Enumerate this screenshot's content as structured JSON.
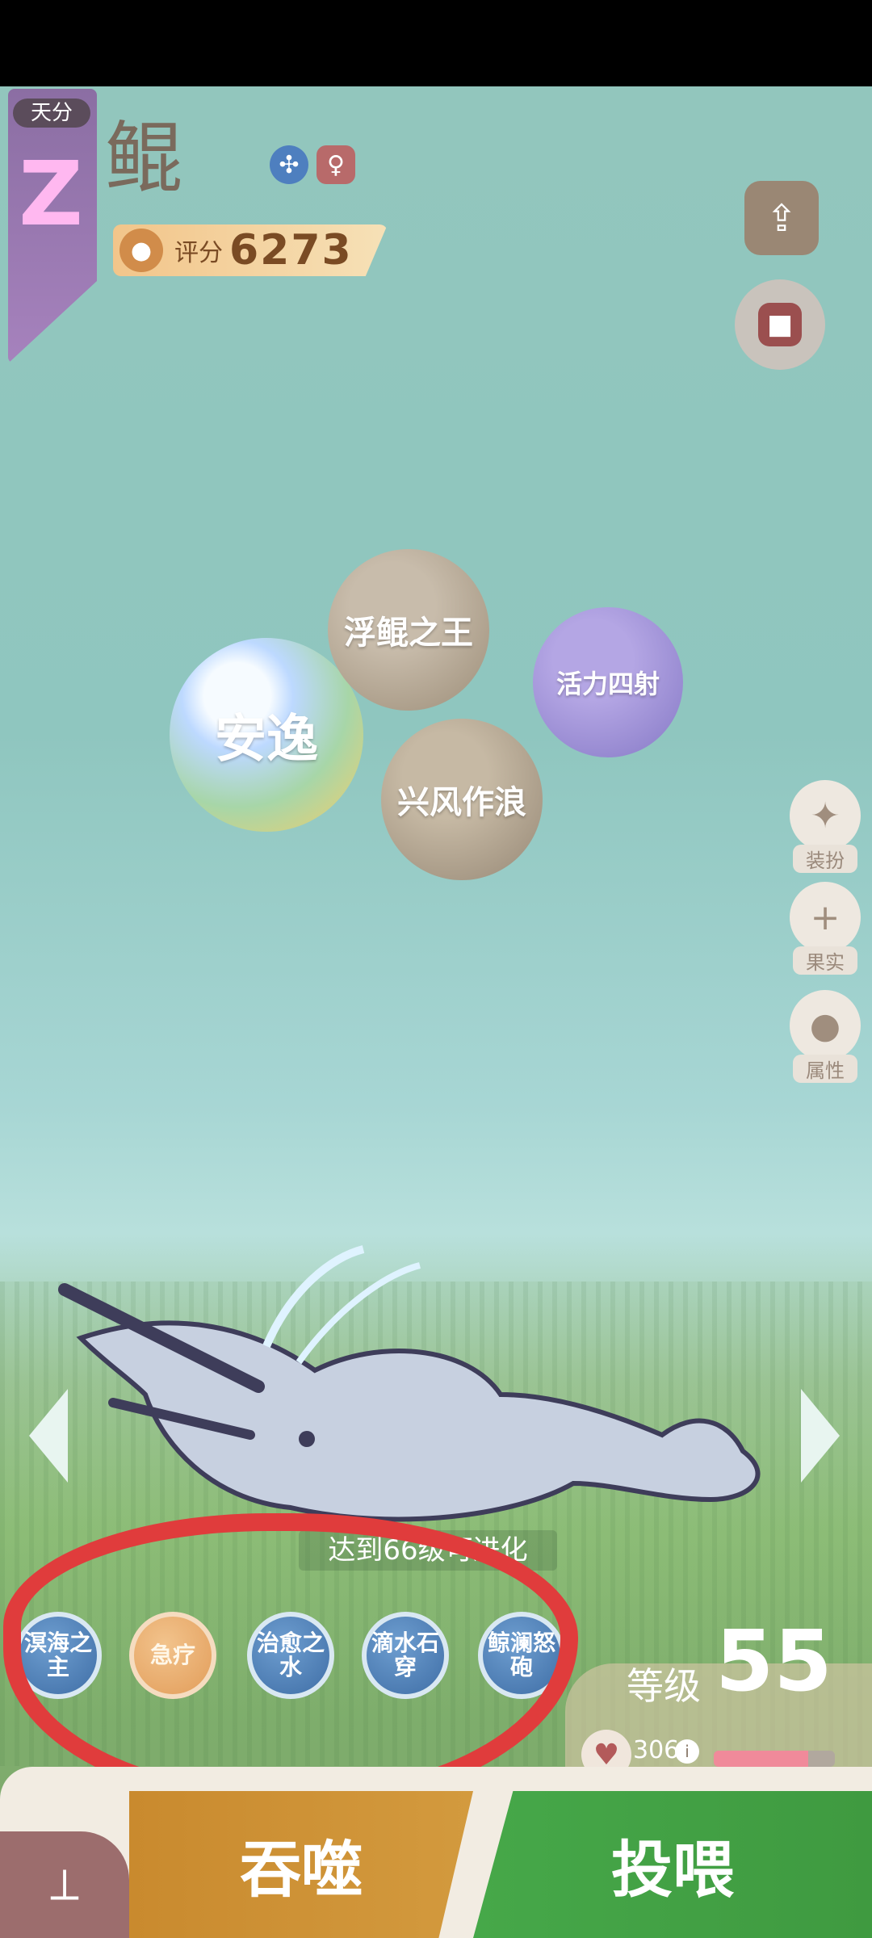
{
  "header": {
    "rank_tag": "天分",
    "rank_letter": "Z",
    "name": "鲲",
    "gender_symbol": "♀",
    "score_label": "评分",
    "score_value": "6273"
  },
  "bubbles": [
    "安逸",
    "浮鲲之王",
    "兴风作浪",
    "活力四射"
  ],
  "side_menu": [
    {
      "label": "装扮"
    },
    {
      "label": "果实"
    },
    {
      "label": "属性"
    }
  ],
  "evolve_text": "达到66级可进化",
  "skills": [
    {
      "label": "溟海之主"
    },
    {
      "label": "急疗"
    },
    {
      "label": "治愈之水"
    },
    {
      "label": "滴水石穿"
    },
    {
      "label": "鲸澜怒砲"
    }
  ],
  "level": {
    "label": "等级",
    "value": "55"
  },
  "hp": {
    "value": "306",
    "fill": 0.78
  },
  "actions": {
    "devour": "吞噬",
    "feed": "投喂"
  },
  "colors": {
    "devour": "#c98a2e",
    "feed": "#46a849",
    "circle": "#e03c3c"
  },
  "icons": [
    "share-icon",
    "lock-icon",
    "paw-icon",
    "butterfly-icon",
    "plus-icon",
    "heart-icon",
    "info-icon"
  ]
}
